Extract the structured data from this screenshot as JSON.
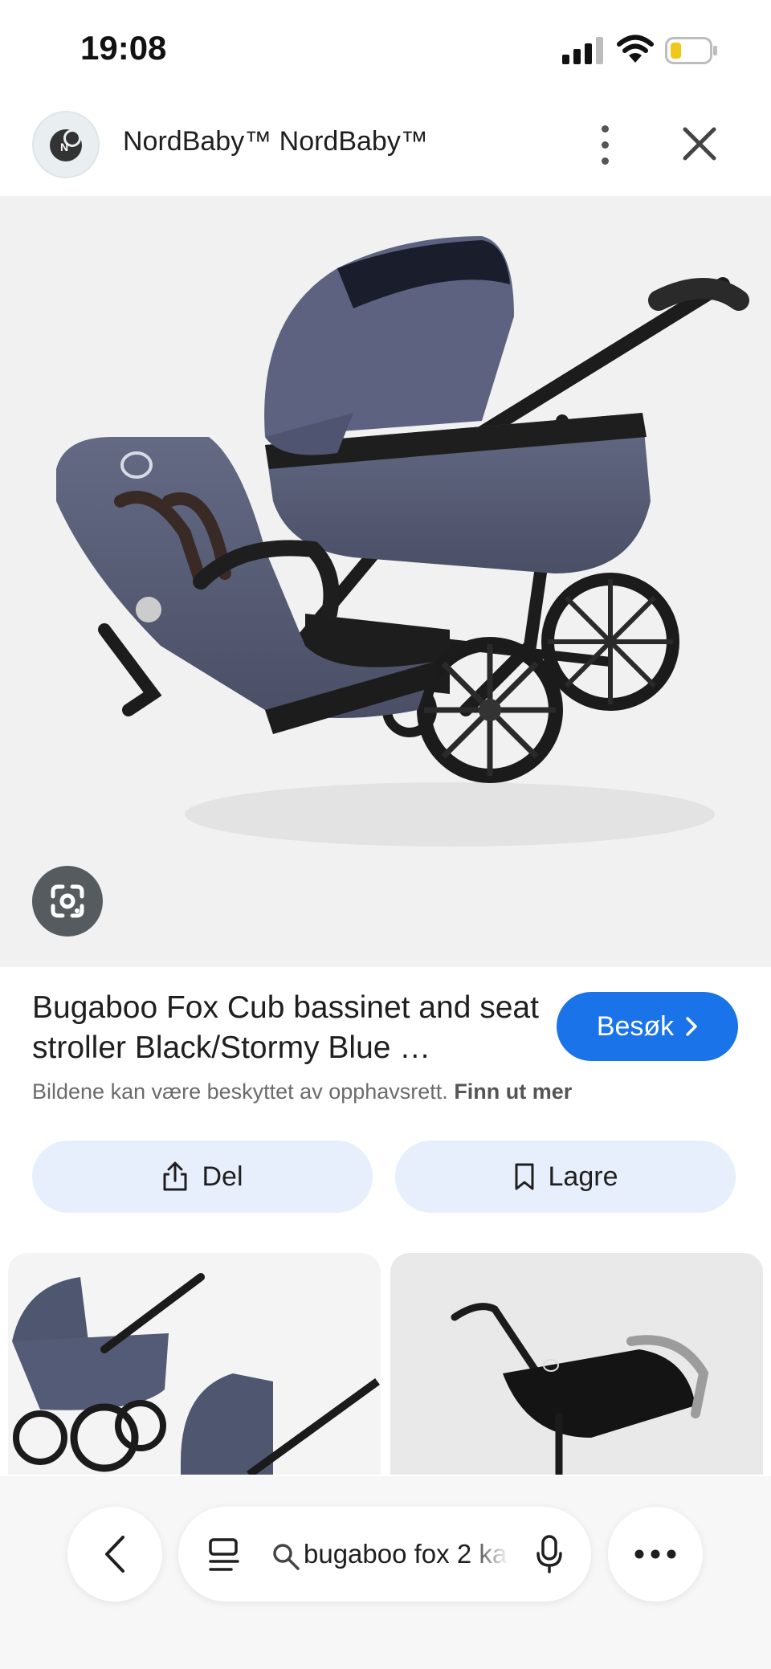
{
  "status_bar": {
    "time": "19:08"
  },
  "header": {
    "site_name": "NordBaby™ NordBaby™"
  },
  "result": {
    "title": "Bugaboo Fox Cub bassinet and seat stroller Black/Stormy Blue …",
    "visit_label": "Besøk",
    "copyright_text": "Bildene kan være beskyttet av opphavsrett.",
    "copyright_link": "Finn ut mer"
  },
  "actions": {
    "share_label": "Del",
    "save_label": "Lagre"
  },
  "search": {
    "query": "bugaboo fox 2 ka"
  },
  "colors": {
    "accent": "#1a73e8",
    "pill_bg": "#e8effc",
    "stroller_fabric": "#5a6078"
  }
}
